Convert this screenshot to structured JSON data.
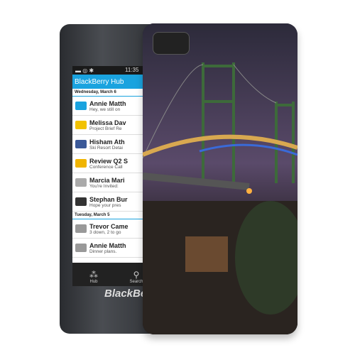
{
  "phone": {
    "status_time": "11:35",
    "hub_title": "BlackBerry Hub",
    "groups": [
      {
        "date": "Wednesday, March 6",
        "items": [
          {
            "name": "Annie Matth",
            "preview": "Hey, we still on",
            "icon": "bbm-icon",
            "color": "#1aa3df"
          },
          {
            "name": "Melissa Dav",
            "preview": "Project Brief Re",
            "icon": "email-icon",
            "color": "#f2c200"
          },
          {
            "name": "Hisham Ath",
            "preview": "Ski Resort Detai",
            "icon": "facebook-icon",
            "color": "#3b5998"
          },
          {
            "name": "Review Q2 S",
            "preview": "Conference Call",
            "icon": "meeting-icon",
            "color": "#f0b400"
          },
          {
            "name": "Marcia Mari",
            "preview": "You're Invited:",
            "icon": "open-envelope-icon",
            "color": "#aaaaaa"
          },
          {
            "name": "Stephan Bur",
            "preview": "Hope your pres",
            "icon": "checkmark-icon",
            "color": "#333333"
          }
        ]
      },
      {
        "date": "Tuesday, March 5",
        "items": [
          {
            "name": "Trevor Came",
            "preview": "3 down, 2 to go",
            "icon": "twitter-icon",
            "color": "#999999"
          },
          {
            "name": "Annie Matth",
            "preview": "Dinner plans.",
            "icon": "bbm-icon",
            "color": "#999999"
          }
        ]
      }
    ],
    "toolbar": {
      "hub": "Hub",
      "search": "Search"
    },
    "brand": "BlackBerry"
  },
  "case": {
    "print": "Night bridge cityscape"
  }
}
